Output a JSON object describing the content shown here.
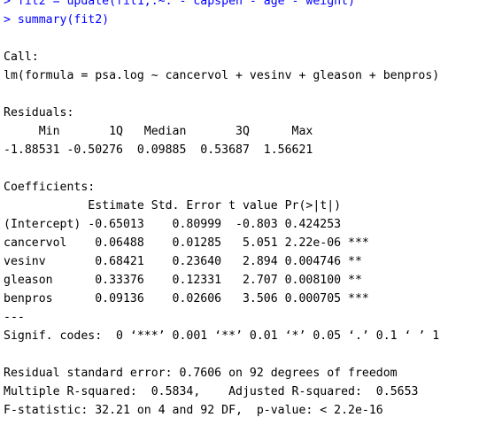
{
  "commands": [
    "> fit2 = update(fit1,.~. - capspen - age - weight)",
    "> summary(fit2)"
  ],
  "output": {
    "blank_1": "",
    "call_header": "Call:",
    "call_formula": "lm(formula = psa.log ~ cancervol + vesinv + gleason + benpros)",
    "blank_2": "",
    "residuals_header": "Residuals:",
    "residuals_labels": "     Min       1Q   Median       3Q      Max ",
    "residuals_values": "-1.88531 -0.50276  0.09885  0.53687  1.56621 ",
    "blank_3": "",
    "coefficients_header": "Coefficients:",
    "coefficients_columns": "            Estimate Std. Error t value Pr(>|t|)    ",
    "coefficients_rows": [
      "(Intercept) -0.65013    0.80999  -0.803 0.424253    ",
      "cancervol    0.06488    0.01285   5.051 2.22e-06 ***",
      "vesinv       0.68421    0.23640   2.894 0.004746 ** ",
      "gleason      0.33376    0.12331   2.707 0.008100 ** ",
      "benpros      0.09136    0.02606   3.506 0.000705 ***"
    ],
    "separator": "---",
    "signif_codes": "Signif. codes:  0 ‘***’ 0.001 ‘**’ 0.01 ‘*’ 0.05 ‘.’ 0.1 ‘ ’ 1",
    "blank_4": "",
    "residual_std_error": "Residual standard error: 0.7606 on 92 degrees of freedom",
    "r_squared": "Multiple R-squared:  0.5834,\tAdjusted R-squared:  0.5653 ",
    "f_statistic": "F-statistic: 32.21 on 4 and 92 DF,  p-value: < 2.2e-16"
  },
  "colors": {
    "command": "#0000ff",
    "output": "#000000",
    "background": "#ffffff"
  }
}
